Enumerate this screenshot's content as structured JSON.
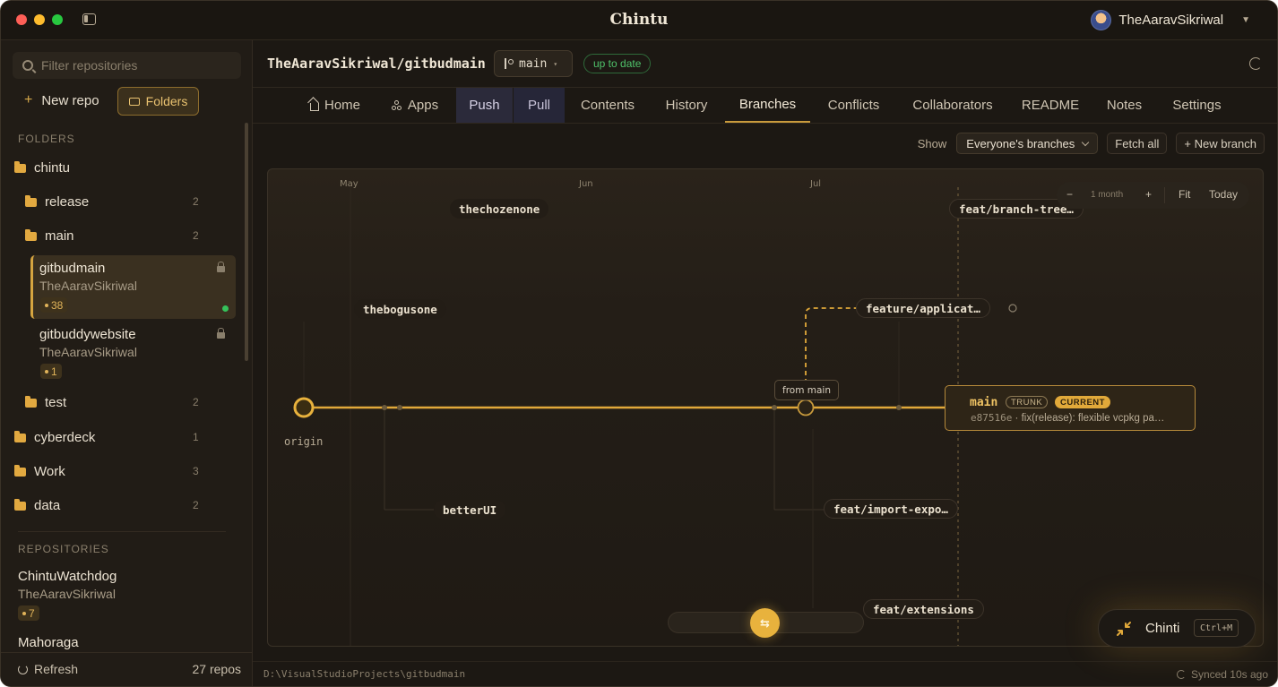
{
  "app": {
    "title": "Chintu",
    "user": "TheAaravSikriwal"
  },
  "sidebar": {
    "filter_placeholder": "Filter repositories",
    "new_repo_label": "New repo",
    "folders_label": "Folders",
    "folders_section": "FOLDERS",
    "repositories_section": "REPOSITORIES",
    "folders": [
      {
        "name": "chintu",
        "count": ""
      },
      {
        "name": "release",
        "count": "2"
      },
      {
        "name": "main",
        "count": "2"
      },
      {
        "name": "test",
        "count": "2"
      },
      {
        "name": "cyberdeck",
        "count": "1"
      },
      {
        "name": "Work",
        "count": "3"
      },
      {
        "name": "data",
        "count": "2"
      }
    ],
    "repos_in_main": [
      {
        "name": "gitbudmain",
        "owner": "TheAaravSikriwal",
        "badge": "38"
      },
      {
        "name": "gitbuddywebsite",
        "owner": "TheAaravSikriwal",
        "badge": "1"
      }
    ],
    "repositories": [
      {
        "name": "ChintuWatchdog",
        "owner": "TheAaravSikriwal",
        "badge": "7"
      },
      {
        "name": "Mahoraga"
      }
    ],
    "refresh_label": "Refresh",
    "repo_count": "27 repos"
  },
  "header": {
    "repo_path": "TheAaravSikriwal/gitbudmain",
    "branch": "main",
    "status": "up to date"
  },
  "tabs": [
    "Home",
    "Apps",
    "Push",
    "Pull",
    "Contents",
    "History",
    "Branches",
    "Conflicts",
    "Collaborators",
    "README",
    "Notes",
    "Settings"
  ],
  "active_tab": "Branches",
  "toolbar": {
    "show_label": "Show",
    "filter_value": "Everyone's branches",
    "fetch_all": "Fetch all",
    "new_branch": "+ New branch"
  },
  "graph": {
    "months": [
      "May",
      "Jun",
      "Jul"
    ],
    "zoom": {
      "minus": "−",
      "level": "1 month",
      "plus": "+",
      "fit": "Fit",
      "today": "Today"
    },
    "branches": [
      "thechozenone",
      "feat/branch-tree…",
      "thebogusone",
      "feature/applicat…",
      "betterUI",
      "feat/import-expo…",
      "feat/extensions"
    ],
    "origin_label": "origin",
    "from_main_label": "from main",
    "main_card": {
      "name": "main",
      "trunk": "TRUNK",
      "current": "CURRENT",
      "sha": "e87516e",
      "message": " · fix(release): flexible vcpkg pa…"
    },
    "scroll_glyph": "⇆"
  },
  "assistant": {
    "label": "Chinti",
    "shortcut": "Ctrl+M"
  },
  "status_bar": {
    "path": "D:\\VisualStudioProjects\\gitbudmain",
    "sync": "Synced 10s ago"
  },
  "colors": {
    "accent": "#e1a93a",
    "background": "#1c1813",
    "success": "#4fc26a"
  }
}
